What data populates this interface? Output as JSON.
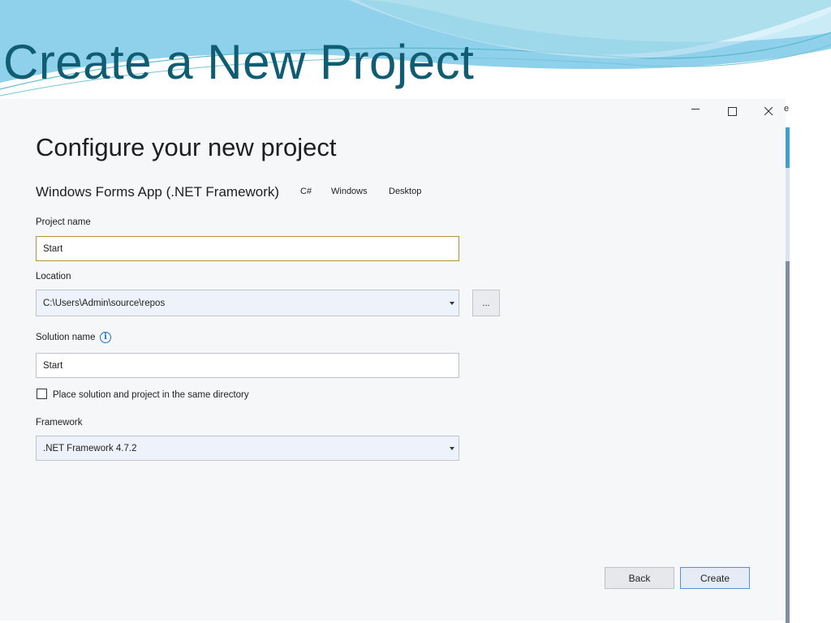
{
  "slide": {
    "title": "Create a New Project"
  },
  "window": {
    "minimize_icon": "minimize-icon",
    "maximize_icon": "maximize-icon",
    "close_icon": "close-icon"
  },
  "dialog": {
    "heading": "Configure your new project",
    "template_name": "Windows Forms App (.NET Framework)",
    "tags": [
      "C#",
      "Windows",
      "Desktop"
    ],
    "project_name": {
      "label": "Project name",
      "value": "Start"
    },
    "location": {
      "label": "Location",
      "value": "C:\\Users\\Admin\\source\\repos",
      "browse_label": "..."
    },
    "solution_name": {
      "label": "Solution name",
      "value": "Start",
      "info_icon": "info-icon"
    },
    "same_directory": {
      "label": "Place solution and project in the same directory",
      "checked": false
    },
    "framework": {
      "label": "Framework",
      "value": ".NET Framework 4.7.2"
    },
    "buttons": {
      "back": "Back",
      "create": "Create"
    }
  },
  "colors": {
    "title": "#0f5c73",
    "focus_border": "#b6913f",
    "primary_border": "#5a8ed6",
    "info": "#1f6fcf"
  }
}
